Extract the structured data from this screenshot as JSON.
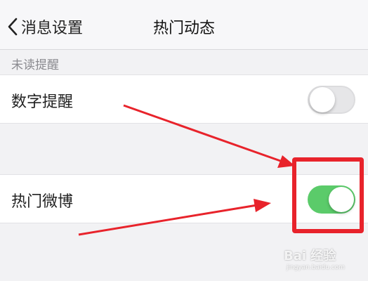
{
  "nav": {
    "back_label": "消息设置",
    "title": "热门动态"
  },
  "sections": {
    "unread_header": "未读提醒"
  },
  "cells": {
    "number_reminder": {
      "label": "数字提醒",
      "toggle": "off"
    },
    "hot_weibo": {
      "label": "热门微博",
      "toggle": "on"
    }
  },
  "colors": {
    "toggle_on": "#5bcb6a",
    "annotation": "#e8232b"
  },
  "watermark": {
    "text": "Bai 经验",
    "url": "jingyan.baidu.com"
  }
}
